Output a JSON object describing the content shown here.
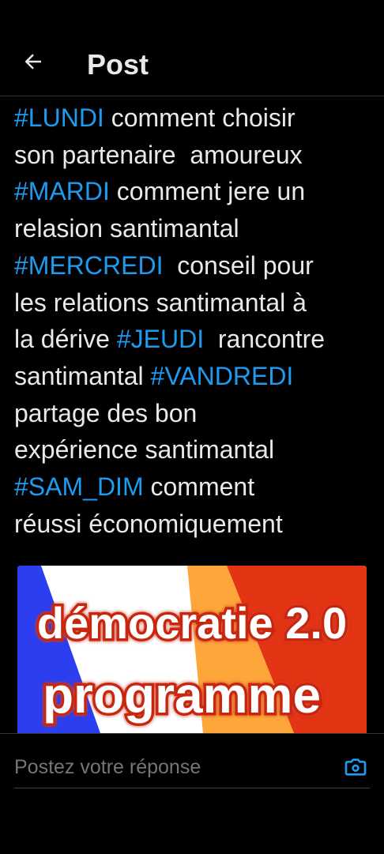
{
  "header": {
    "back_icon": "arrow-left-icon",
    "title": "Post"
  },
  "post": {
    "lines": [
      [
        {
          "text": "#LUNDI",
          "tag": true
        },
        {
          "text": " comment choisir",
          "tag": false
        }
      ],
      [
        {
          "text": "son partenaire  amoureux",
          "tag": false
        }
      ],
      [
        {
          "text": "#MARDI",
          "tag": true
        },
        {
          "text": " comment jere un",
          "tag": false
        }
      ],
      [
        {
          "text": "relasion santimantal",
          "tag": false
        }
      ],
      [
        {
          "text": "#MERCREDI",
          "tag": true
        },
        {
          "text": "  conseil pour",
          "tag": false
        }
      ],
      [
        {
          "text": "les relations santimantal à",
          "tag": false
        }
      ],
      [
        {
          "text": "la dérive ",
          "tag": false
        },
        {
          "text": "#JEUDI",
          "tag": true
        },
        {
          "text": "  rancontre",
          "tag": false
        }
      ],
      [
        {
          "text": "santimantal ",
          "tag": false
        },
        {
          "text": "#VANDREDI",
          "tag": true
        }
      ],
      [
        {
          "text": "partage des bon",
          "tag": false
        }
      ],
      [
        {
          "text": "expérience santimantal",
          "tag": false
        }
      ],
      [
        {
          "text": "#SAM_DIM",
          "tag": true
        },
        {
          "text": " comment",
          "tag": false
        }
      ],
      [
        {
          "text": "réussi économiquement",
          "tag": false
        }
      ]
    ]
  },
  "media": {
    "line1": "démocratie 2.0",
    "line2": "programme",
    "colors": {
      "blue": "#2b3ff0",
      "white": "#ffffff",
      "orange": "#ffa63b",
      "red": "#e33414",
      "text_fill": "#ffffff",
      "text_stroke": "#c8270f"
    }
  },
  "reply": {
    "placeholder": "Postez votre réponse",
    "camera_icon": "camera-icon"
  },
  "theme": {
    "background": "#000000",
    "text": "#e7e9ea",
    "hashtag": "#1d9bf0",
    "placeholder": "#71767b",
    "accent": "#1d9bf0"
  }
}
